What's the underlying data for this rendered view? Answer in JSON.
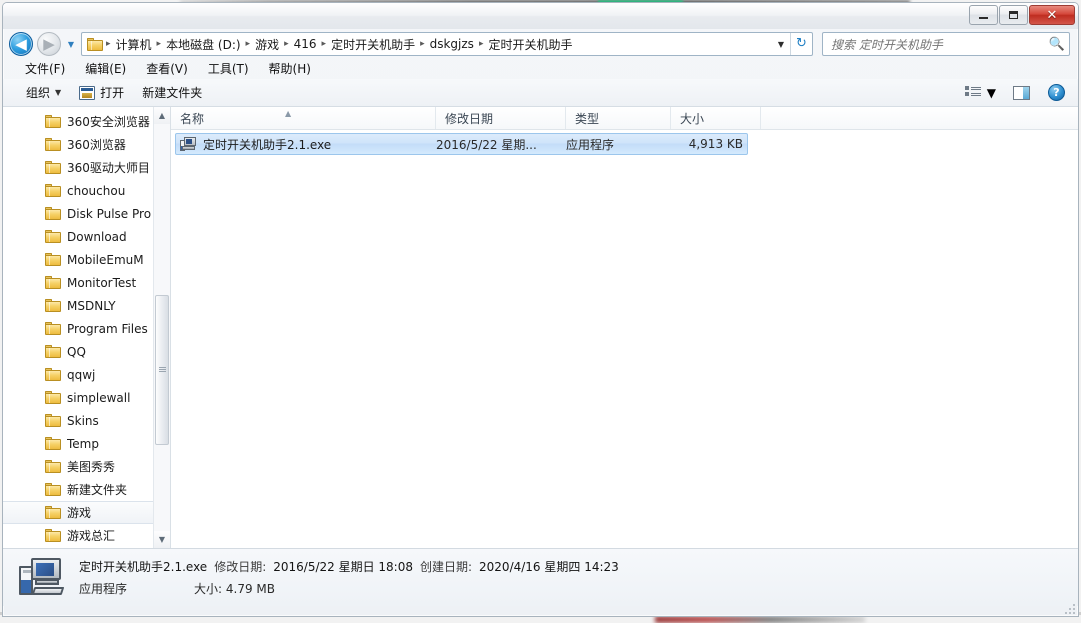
{
  "window": {
    "title_blurred": true,
    "controls": {
      "minimize": "minimize",
      "restore": "restore",
      "close": "✕"
    }
  },
  "address_bar": {
    "back_glyph": "◀",
    "forward_glyph": "▶",
    "history_caret": "▼",
    "folder_icon": "folder-icon",
    "crumbs": [
      "计算机",
      "本地磁盘 (D:)",
      "游戏",
      "416",
      "定时开关机助手",
      "dskgjzs",
      "定时开关机助手"
    ],
    "separator": "▸",
    "dropdown_caret": "▼",
    "refresh_glyph": "↻"
  },
  "search": {
    "placeholder": "搜索 定时开关机助手",
    "icon": "search-icon",
    "magnifier": "🔍"
  },
  "menubar": {
    "items": [
      {
        "label": "文件(F)"
      },
      {
        "label": "编辑(E)"
      },
      {
        "label": "查看(V)"
      },
      {
        "label": "工具(T)"
      },
      {
        "label": "帮助(H)"
      }
    ]
  },
  "toolbar": {
    "organize_label": "组织",
    "organize_caret": "▼",
    "open_label": "打开",
    "newfolder_label": "新建文件夹",
    "view_caret": "▼",
    "help_glyph": "?"
  },
  "nav_pane": {
    "items": [
      {
        "label": "360安全浏览器",
        "selected": false
      },
      {
        "label": "360浏览器",
        "selected": false
      },
      {
        "label": "360驱动大师目",
        "selected": false
      },
      {
        "label": "chouchou",
        "selected": false
      },
      {
        "label": "Disk Pulse Pro",
        "selected": false
      },
      {
        "label": "Download",
        "selected": false
      },
      {
        "label": "MobileEmuM",
        "selected": false
      },
      {
        "label": "MonitorTest",
        "selected": false
      },
      {
        "label": "MSDNLY",
        "selected": false
      },
      {
        "label": "Program Files",
        "selected": false
      },
      {
        "label": "QQ",
        "selected": false
      },
      {
        "label": "qqwj",
        "selected": false
      },
      {
        "label": "simplewall",
        "selected": false
      },
      {
        "label": "Skins",
        "selected": false
      },
      {
        "label": "Temp",
        "selected": false
      },
      {
        "label": "美图秀秀",
        "selected": false
      },
      {
        "label": "新建文件夹",
        "selected": false
      },
      {
        "label": "游戏",
        "selected": true
      },
      {
        "label": "游戏总汇",
        "selected": false
      }
    ],
    "scroll_up": "▲",
    "scroll_down": "▼"
  },
  "file_list": {
    "columns": [
      {
        "key": "name",
        "label": "名称",
        "sorted": true,
        "sort_glyph": "▲"
      },
      {
        "key": "date",
        "label": "修改日期",
        "sorted": false
      },
      {
        "key": "type",
        "label": "类型",
        "sorted": false
      },
      {
        "key": "size",
        "label": "大小",
        "sorted": false
      }
    ],
    "rows": [
      {
        "icon": "application-exe-icon",
        "name": "定时开关机助手2.1.exe",
        "date": "2016/5/22 星期...",
        "type": "应用程序",
        "size": "4,913 KB",
        "selected": true
      }
    ]
  },
  "status_bar": {
    "icon": "computer-application-icon",
    "file_name": "定时开关机助手2.1.exe",
    "modified_label": "修改日期:",
    "modified_value": "2016/5/22 星期日 18:08",
    "created_label": "创建日期:",
    "created_value": "2020/4/16 星期四 14:23",
    "file_type": "应用程序",
    "size_label": "大小:",
    "size_value": "4.79 MB"
  },
  "colors": {
    "selection_blue": "#c3dcf8",
    "selection_border": "#9cc6ec",
    "close_red": "#bf2d20",
    "accent_green": "#27bb7e",
    "folder_yellow": "#f6d269"
  }
}
